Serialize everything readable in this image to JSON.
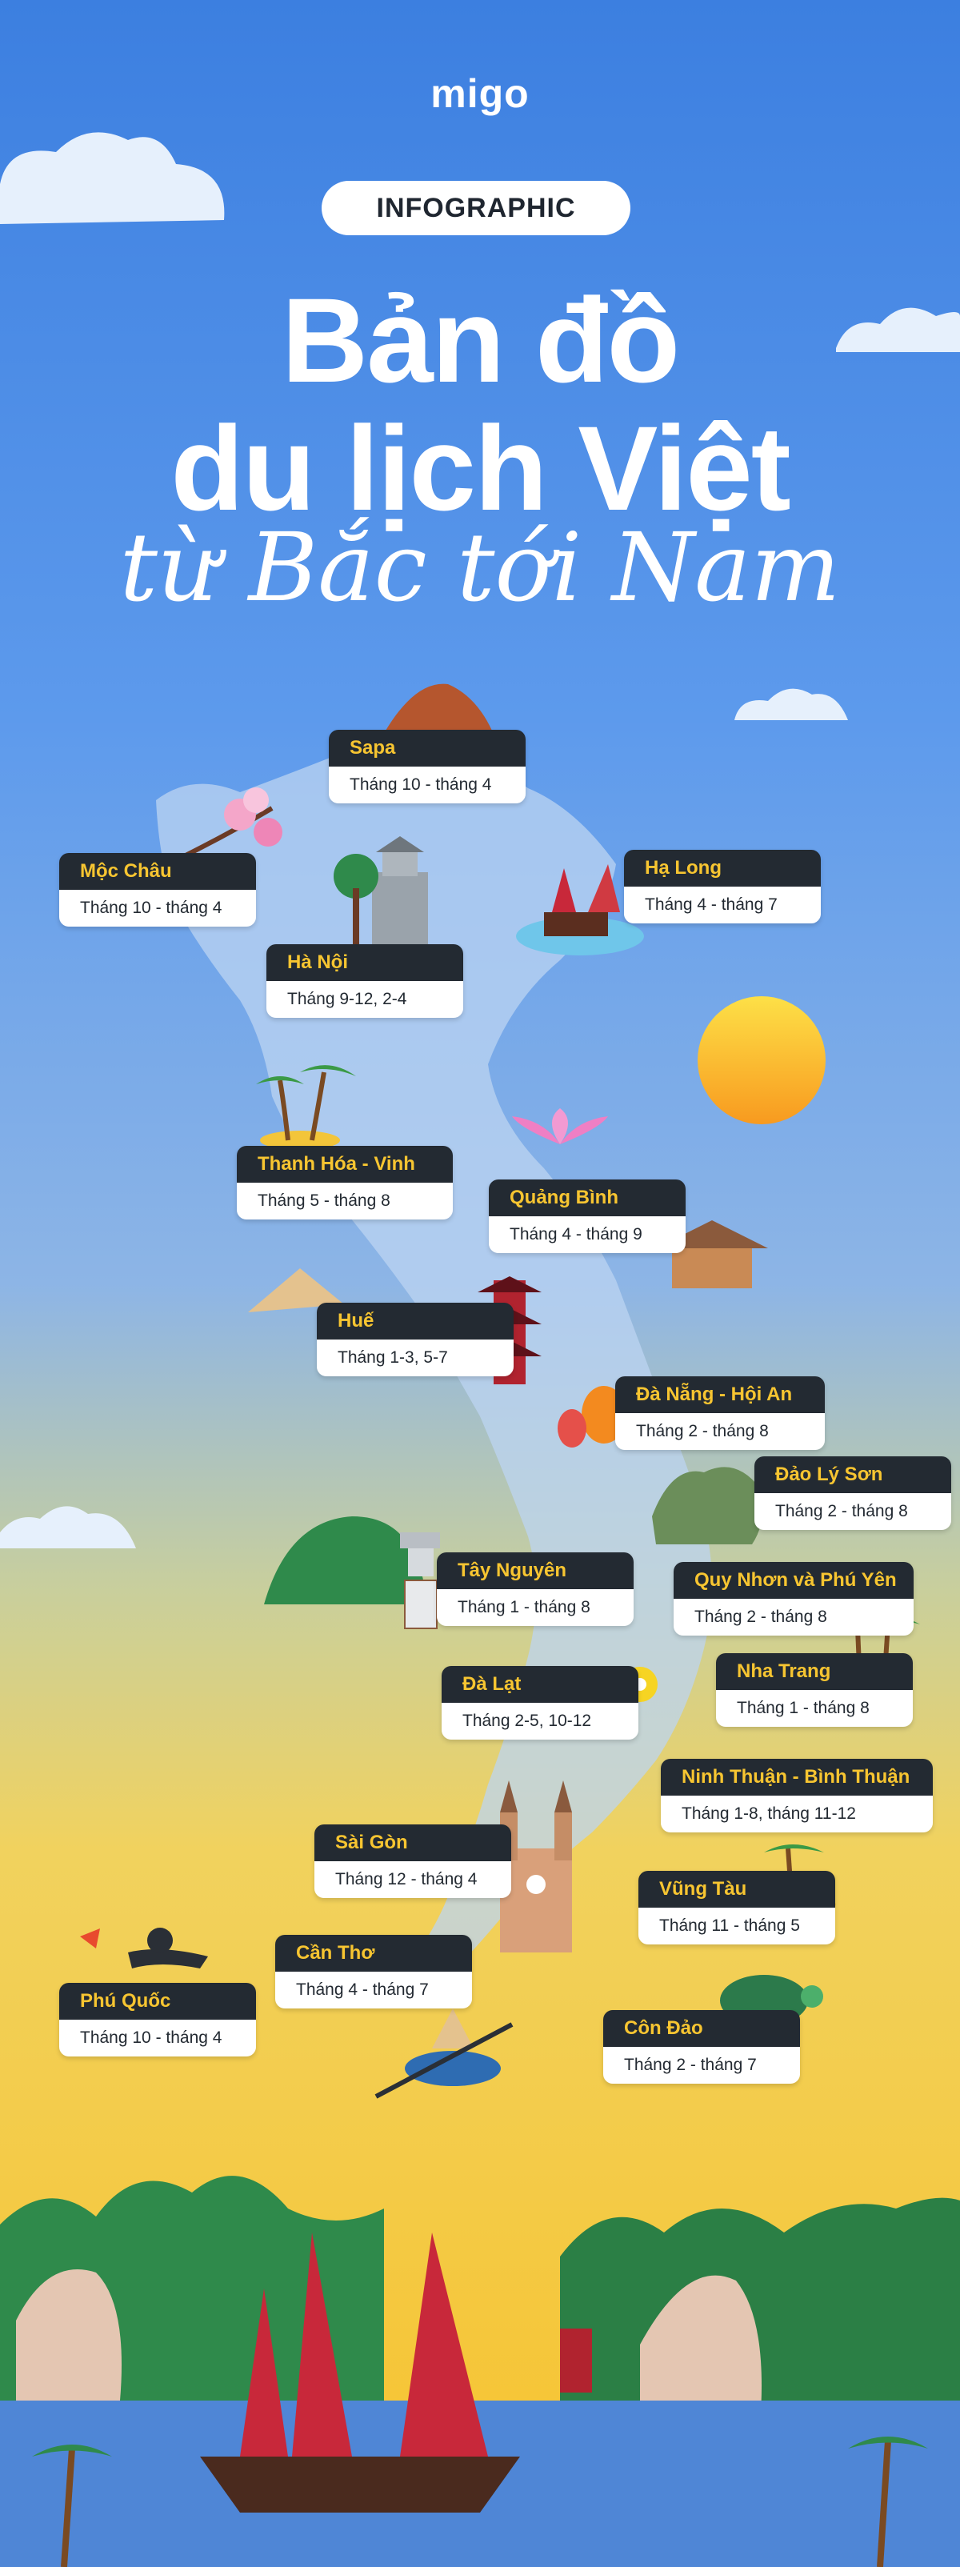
{
  "brand": "migo",
  "badge": "INFOGRAPHIC",
  "title_line1": "Bản đồ",
  "title_line2": "du lịch Việt",
  "title_line3": "từ Bắc tới Nam",
  "colors": {
    "sky_top": "#3c7fe0",
    "sky_mid": "#8bb9f2",
    "sky_bottom": "#f4c534",
    "card_header": "#232a32",
    "card_title": "#f7c531",
    "sun": "#fbb62e",
    "sea": "#4f86d6"
  },
  "destinations": [
    {
      "name": "Sapa",
      "months": "Tháng 10 - tháng 4"
    },
    {
      "name": "Mộc Châu",
      "months": "Tháng 10 - tháng 4"
    },
    {
      "name": "Hạ Long",
      "months": "Tháng 4 - tháng 7"
    },
    {
      "name": "Hà Nội",
      "months": "Tháng 9-12, 2-4"
    },
    {
      "name": "Thanh Hóa - Vinh",
      "months": "Tháng 5 - tháng 8"
    },
    {
      "name": "Quảng Bình",
      "months": "Tháng 4 - tháng 9"
    },
    {
      "name": "Huế",
      "months": "Tháng 1-3, 5-7"
    },
    {
      "name": "Đà Nẵng - Hội An",
      "months": "Tháng 2 - tháng 8"
    },
    {
      "name": "Đảo Lý Sơn",
      "months": "Tháng 2 - tháng 8"
    },
    {
      "name": "Tây Nguyên",
      "months": "Tháng 1 - tháng 8"
    },
    {
      "name": "Quy Nhơn và Phú Yên",
      "months": "Tháng 2 - tháng 8"
    },
    {
      "name": "Nha Trang",
      "months": "Tháng 1 - tháng 8"
    },
    {
      "name": "Đà Lạt",
      "months": "Tháng 2-5, 10-12"
    },
    {
      "name": "Ninh Thuận - Bình Thuận",
      "months": "Tháng 1-8, tháng 11-12"
    },
    {
      "name": "Sài Gòn",
      "months": "Tháng 12 - tháng 4"
    },
    {
      "name": "Vũng Tàu",
      "months": "Tháng 11 - tháng 5"
    },
    {
      "name": "Cần Thơ",
      "months": "Tháng 4 - tháng 7"
    },
    {
      "name": "Phú Quốc",
      "months": "Tháng 10 - tháng 4"
    },
    {
      "name": "Côn Đảo",
      "months": "Tháng 2 - tháng 7"
    }
  ]
}
